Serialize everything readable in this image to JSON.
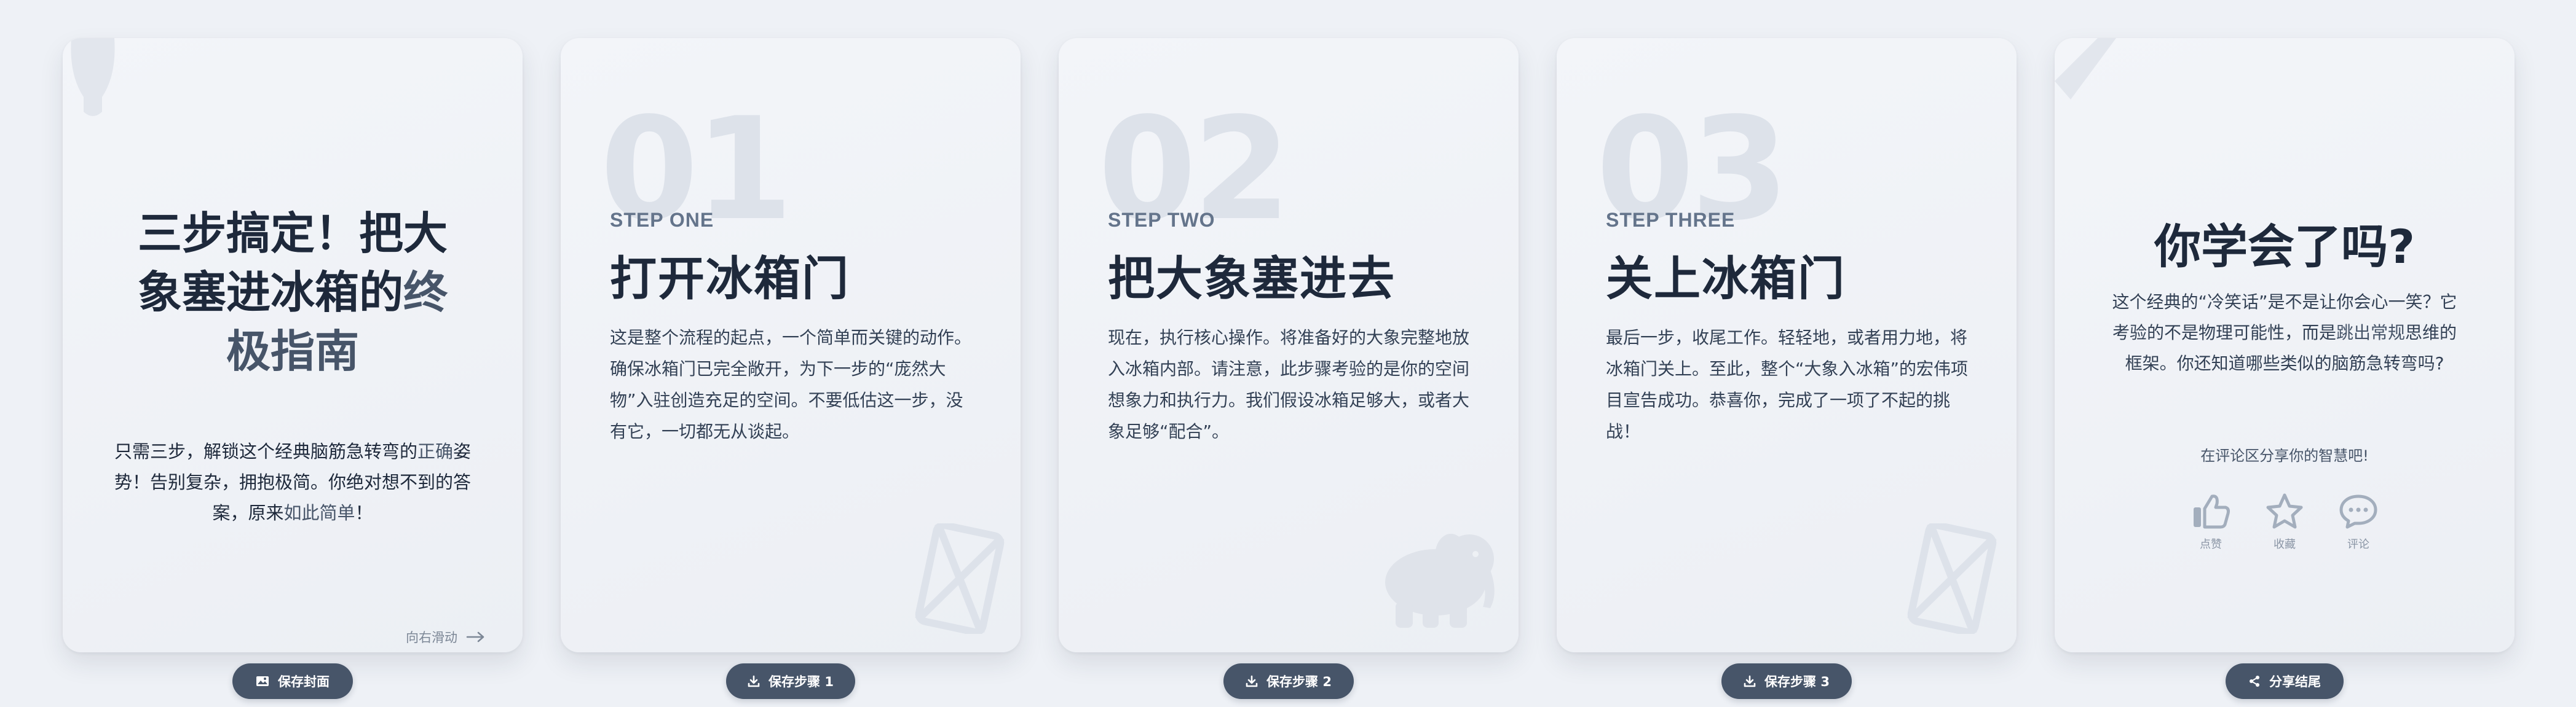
{
  "cover": {
    "title_l1": "三步搞定！把大",
    "title_l2a": "象塞进冰箱的",
    "title_l2b": "终",
    "title_l3": "极指南",
    "body_a": "只需三步，解锁这个经典脑筋急转弯的",
    "body_b": "正确",
    "body_c": "姿势！告别复杂，拥抱极简。你绝对想不到的答案，原来",
    "body_d": "如此简单",
    "body_e": "！",
    "swipe_hint": "向右滑动"
  },
  "steps": [
    {
      "number": "01",
      "label": "STEP ONE",
      "title": "打开冰箱门",
      "body": "这是整个流程的起点，一个简单而关键的动作。确保冰箱门已完全敞开，为下一步的“庞然大物”入驻创造充足的空间。不要低估这一步，没有它，一切都无从谈起。"
    },
    {
      "number": "02",
      "label": "STEP TWO",
      "title": "把大象塞进去",
      "body": "现在，执行核心操作。将准备好的大象完整地放入冰箱内部。请注意，此步骤考验的是你的空间想象力和执行力。我们假设冰箱足够大，或者大象足够“配合”。"
    },
    {
      "number": "03",
      "label": "STEP THREE",
      "title": "关上冰箱门",
      "body": "最后一步，收尾工作。轻轻地，或者用力地，将冰箱门关上。至此，整个“大象入冰箱”的宏伟项目宣告成功。恭喜你，完成了一项了不起的挑战！"
    }
  ],
  "end": {
    "title": "你学会了吗?",
    "body_a": "这个经典的“冷笑话”是不是让你会心一笑？它考验的不是物理可能性，而是",
    "body_b": "跳出常规",
    "body_c": "思维的框架。你还知道哪些类似的脑筋急转弯吗?",
    "cta": "在评论区分享你的智慧吧!",
    "like": "点赞",
    "favorite": "收藏",
    "comment": "评论"
  },
  "buttons": {
    "save_cover": "保存封面",
    "save_step1": "保存步骤 1",
    "save_step2": "保存步骤 2",
    "save_step3": "保存步骤 3",
    "share_end": "分享结尾"
  },
  "icons": {
    "image": "image-icon",
    "download": "download-icon",
    "share": "share-icon",
    "arrow": "arrow-right-icon",
    "like": "thumbs-up-icon",
    "favorite": "star-icon",
    "comment": "comment-icon",
    "fridge": "fridge-icon",
    "elephant": "elephant-icon"
  },
  "colors": {
    "page_bg": "#eef1f6",
    "card_bg": "#f0f3f7",
    "text": "#1e293b",
    "accent": "#475569",
    "button_bg": "#475569"
  }
}
